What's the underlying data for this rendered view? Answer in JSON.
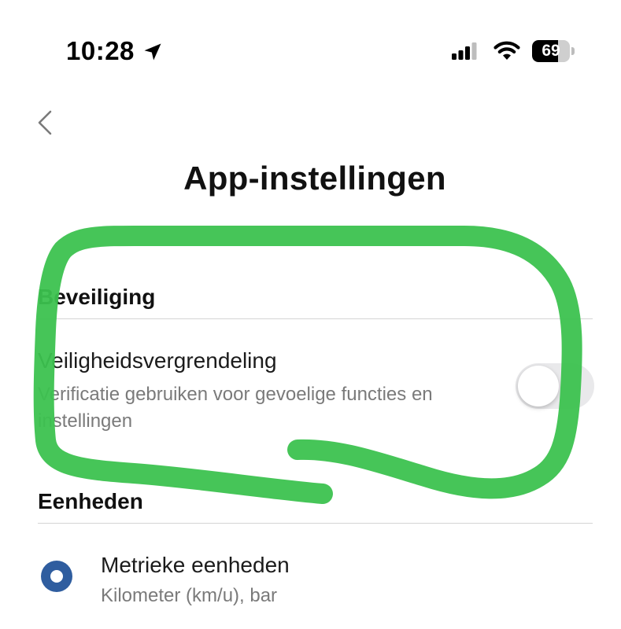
{
  "status_bar": {
    "time": "10:28",
    "battery_level": "69",
    "battery_fraction": 0.69
  },
  "nav": {
    "back_icon": "chevron-left-icon"
  },
  "page": {
    "title": "App-instellingen"
  },
  "sections": {
    "security": {
      "header": "Beveiliging",
      "setting": {
        "title": "Veiligheidsvergrendeling",
        "description": "Verificatie gebruiken voor gevoelige functies en instellingen",
        "enabled": false
      }
    },
    "units": {
      "header": "Eenheden",
      "option": {
        "title": "Metrieke eenheden",
        "description": "Kilometer (km/u), bar",
        "selected": true
      }
    }
  },
  "colors": {
    "highlight": "#3cc24f",
    "radio_accent": "#2f5d9f",
    "toggle_off": "#e9e9eb",
    "secondary_text": "#7a7a7a"
  }
}
